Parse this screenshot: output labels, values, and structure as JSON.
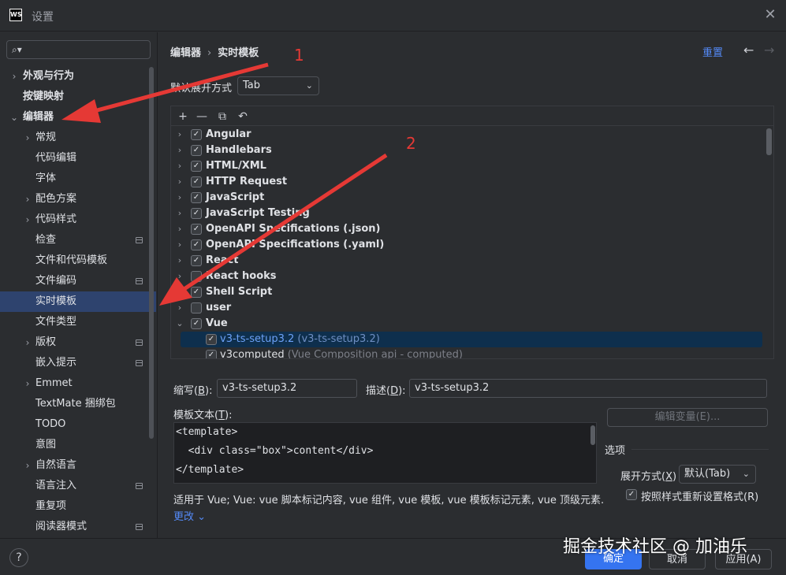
{
  "window": {
    "logo": "WS",
    "title": "设置",
    "close_icon": "✕"
  },
  "sidebar": {
    "search_icon": "🔍",
    "items": [
      {
        "label": "外观与行为",
        "chevron": "›",
        "bold": true
      },
      {
        "label": "按键映射",
        "chevron": "",
        "bold": true
      },
      {
        "label": "编辑器",
        "chevron": "⌄",
        "bold": true
      },
      {
        "label": "常规",
        "chevron": "›"
      },
      {
        "label": "代码编辑",
        "chevron": ""
      },
      {
        "label": "字体",
        "chevron": ""
      },
      {
        "label": "配色方案",
        "chevron": "›"
      },
      {
        "label": "代码样式",
        "chevron": "›"
      },
      {
        "label": "检查",
        "chevron": "",
        "badge": true
      },
      {
        "label": "文件和代码模板",
        "chevron": ""
      },
      {
        "label": "文件编码",
        "chevron": "",
        "badge": true
      },
      {
        "label": "实时模板",
        "chevron": "",
        "selected": true
      },
      {
        "label": "文件类型",
        "chevron": ""
      },
      {
        "label": "版权",
        "chevron": "›",
        "badge": true
      },
      {
        "label": "嵌入提示",
        "chevron": "",
        "badge": true
      },
      {
        "label": "Emmet",
        "chevron": "›"
      },
      {
        "label": "TextMate 捆绑包",
        "chevron": ""
      },
      {
        "label": "TODO",
        "chevron": ""
      },
      {
        "label": "意图",
        "chevron": ""
      },
      {
        "label": "自然语言",
        "chevron": "›"
      },
      {
        "label": "语言注入",
        "chevron": "",
        "badge": true
      },
      {
        "label": "重复项",
        "chevron": ""
      },
      {
        "label": "阅读器模式",
        "chevron": "",
        "badge": true
      }
    ]
  },
  "header": {
    "crumb1": "编辑器",
    "crumb_sep": "›",
    "crumb2": "实时模板",
    "reset": "重置",
    "back_icon": "←",
    "forward_icon": "→"
  },
  "expand": {
    "label": "默认展开方式",
    "value": "Tab",
    "caret": "⌄"
  },
  "toolbar": {
    "add": "+",
    "remove": "—",
    "copy": "⧉",
    "restore": "↶"
  },
  "template_groups": [
    {
      "name": "Angular",
      "checked": true,
      "chevron": "›"
    },
    {
      "name": "Handlebars",
      "checked": true,
      "chevron": "›"
    },
    {
      "name": "HTML/XML",
      "checked": true,
      "chevron": "›"
    },
    {
      "name": "HTTP Request",
      "checked": true,
      "chevron": "›"
    },
    {
      "name": "JavaScript",
      "checked": true,
      "chevron": "›"
    },
    {
      "name": "JavaScript Testing",
      "checked": true,
      "chevron": "›"
    },
    {
      "name": "OpenAPI Specifications (.json)",
      "checked": true,
      "chevron": "›"
    },
    {
      "name": "OpenAPI Specifications (.yaml)",
      "checked": true,
      "chevron": "›"
    },
    {
      "name": "React",
      "checked": true,
      "chevron": "›"
    },
    {
      "name": "React hooks",
      "checked": false,
      "chevron": "›"
    },
    {
      "name": "Shell Script",
      "checked": true,
      "chevron": "›"
    },
    {
      "name": "user",
      "checked": false,
      "chevron": "›"
    },
    {
      "name": "Vue",
      "checked": true,
      "chevron": "⌄"
    }
  ],
  "template_items": [
    {
      "name": "v3-ts-setup3.2",
      "desc": "(v3-ts-setup3.2)",
      "checked": true,
      "selected": true
    },
    {
      "name": "v3computed",
      "desc": "(Vue Composition api - computed)",
      "checked": true,
      "selected": false
    }
  ],
  "abbrev": {
    "label_pre": "缩写(",
    "label_key": "B",
    "label_post": "):",
    "value": "v3-ts-setup3.2"
  },
  "description": {
    "label_pre": "描述(",
    "label_key": "D",
    "label_post": "):",
    "value": "v3-ts-setup3.2"
  },
  "template_text": {
    "label_pre": "模板文本(",
    "label_key": "T",
    "label_post": "):",
    "lines": [
      "<template>",
      "  <div class=\"box\">content</div>",
      "</template>"
    ]
  },
  "edit_variables": "编辑变量(E)...",
  "options": {
    "title": "选项",
    "expand_label_pre": "展开方式(",
    "expand_label_key": "X",
    "expand_label_post": ")",
    "expand_value": "默认(Tab)",
    "reformat_label": "按照样式重新设置格式(R)",
    "reformat_checked": true
  },
  "applicable": "适用于 Vue; Vue: vue 脚本标记内容, vue 组件, vue 模板, vue 模板标记元素, vue 顶级元素.",
  "change_link": "更改 ⌄",
  "footer": {
    "help": "?",
    "ok": "确定",
    "cancel": "取消",
    "apply": "应用(A)"
  },
  "watermark": "掘金技术社区 @ 加油乐",
  "annotations": {
    "one": "1",
    "two": "2",
    "arrow_color": "#e53935"
  }
}
